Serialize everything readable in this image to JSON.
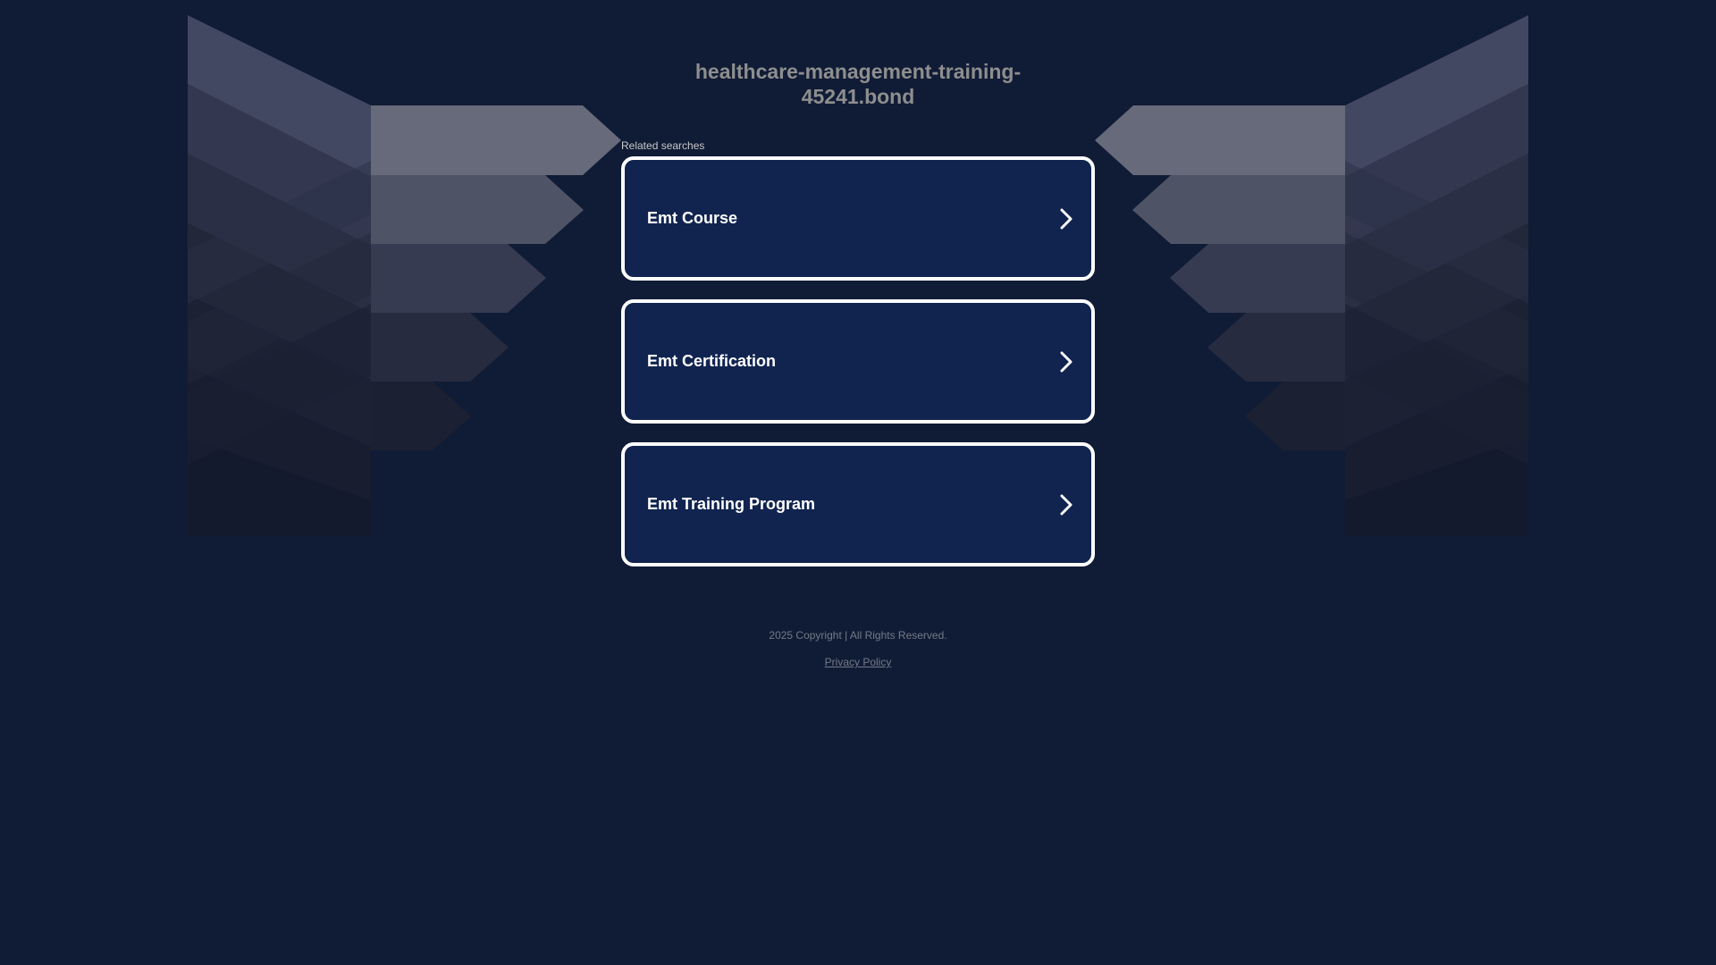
{
  "site": {
    "title": "healthcare-management-training-45241.bond"
  },
  "related": {
    "label": "Related searches",
    "items": [
      {
        "label": "Emt Course"
      },
      {
        "label": "Emt Certification"
      },
      {
        "label": "Emt Training Program"
      }
    ]
  },
  "footer": {
    "copyright": "2025 Copyright | All Rights Reserved.",
    "privacy_label": "Privacy Policy"
  },
  "colors": {
    "background": "#101c36",
    "card": "#112450",
    "card_border": "#ffffff",
    "title": "#8e8e8e",
    "footer_text": "#747a86"
  },
  "icons": {
    "result_arrow": "chevron-right-icon"
  }
}
